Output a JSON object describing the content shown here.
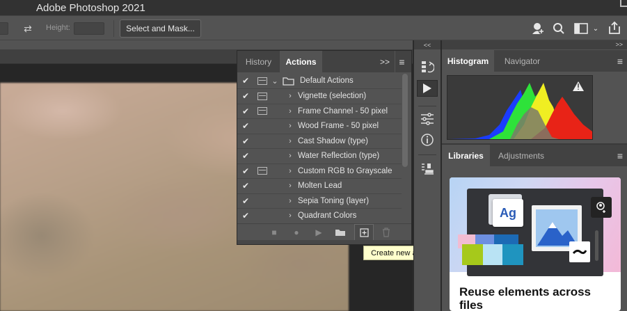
{
  "app": {
    "title": "Adobe Photoshop 2021"
  },
  "options_bar": {
    "height_label": "Height:",
    "select_mask_label": "Select and Mask..."
  },
  "actions_panel": {
    "tabs": [
      {
        "label": "History"
      },
      {
        "label": "Actions"
      }
    ],
    "expand_glyph": ">>",
    "set_name": "Default Actions",
    "items": [
      {
        "label": "Vignette (selection)",
        "dialog": true
      },
      {
        "label": "Frame Channel - 50 pixel",
        "dialog": true
      },
      {
        "label": "Wood Frame - 50 pixel",
        "dialog": false
      },
      {
        "label": "Cast Shadow (type)",
        "dialog": false
      },
      {
        "label": "Water Reflection (type)",
        "dialog": false
      },
      {
        "label": "Custom RGB to Grayscale",
        "dialog": true
      },
      {
        "label": "Molten Lead",
        "dialog": false
      },
      {
        "label": "Sepia Toning (layer)",
        "dialog": false
      },
      {
        "label": "Quadrant Colors",
        "dialog": false
      }
    ],
    "tooltip": "Create new action"
  },
  "histogram_panel": {
    "tabs": [
      {
        "label": "Histogram"
      },
      {
        "label": "Navigator"
      }
    ],
    "warning_icon": "warning-icon"
  },
  "libraries_panel": {
    "tabs": [
      {
        "label": "Libraries"
      },
      {
        "label": "Adjustments"
      }
    ],
    "card_title": "Reuse elements across files",
    "art_text": "Ag"
  },
  "strip": {
    "collapse_glyph": "<<"
  },
  "right_top": {
    "collapse_glyph": ">>"
  },
  "colors": {
    "panel": "#535353",
    "dark": "#424242",
    "accent": "#ffffcc"
  }
}
